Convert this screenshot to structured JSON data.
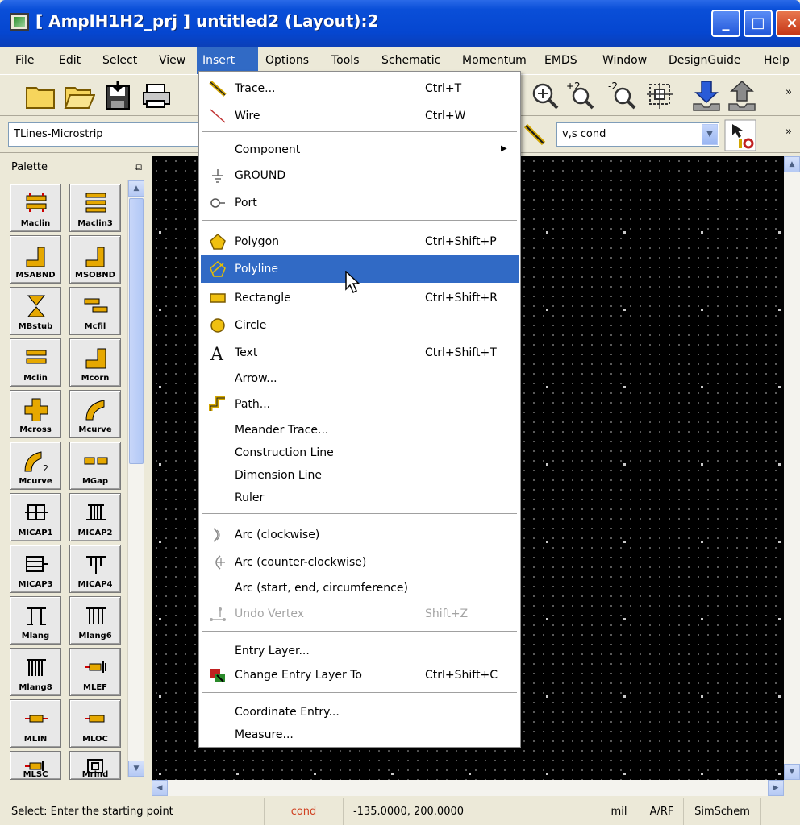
{
  "window": {
    "title": "[ AmplH1H2_prj ] untitled2 (Layout):2",
    "min_label": "_",
    "max_label": "□",
    "close_label": "×"
  },
  "menubar": {
    "items": [
      "File",
      "Edit",
      "Select",
      "View",
      "Insert",
      "Options",
      "Tools",
      "Schematic",
      "Momentum",
      "EMDS",
      "Window",
      "DesignGuide",
      "Help"
    ],
    "active": "Insert"
  },
  "toolbar": {
    "library_value": "TLines-Microstrip",
    "layer_value": "v,s cond",
    "overflow": "»"
  },
  "palette": {
    "header": "Palette",
    "pin_icon": "pin-icon",
    "items": [
      "Maclin",
      "Maclin3",
      "MSABND",
      "MSOBND",
      "MBstub",
      "Mcfil",
      "Mclin",
      "Mcorn",
      "Mcross",
      "Mcurve",
      "Mcurve",
      "MGap",
      "MICAP1",
      "MICAP2",
      "MICAP3",
      "MICAP4",
      "Mlang",
      "Mlang6",
      "Mlang8",
      "MLEF",
      "MLIN",
      "MLOC",
      "MLSC",
      "Mrind"
    ]
  },
  "insert_menu": {
    "groups": [
      [
        {
          "label": "Trace...",
          "shortcut": "Ctrl+T",
          "icon": "trace-icon"
        },
        {
          "label": "Wire",
          "shortcut": "Ctrl+W",
          "icon": "wire-icon"
        }
      ],
      [
        {
          "label": "Component",
          "shortcut": "",
          "icon": "",
          "submenu": true
        },
        {
          "label": "GROUND",
          "shortcut": "",
          "icon": "ground-icon"
        },
        {
          "label": "Port",
          "shortcut": "",
          "icon": "port-icon"
        }
      ],
      [
        {
          "label": "Polygon",
          "shortcut": "Ctrl+Shift+P",
          "icon": "polygon-icon"
        },
        {
          "label": "Polyline",
          "shortcut": "",
          "icon": "polyline-icon",
          "selected": true
        },
        {
          "label": "Rectangle",
          "shortcut": "Ctrl+Shift+R",
          "icon": "rectangle-icon"
        },
        {
          "label": "Circle",
          "shortcut": "",
          "icon": "circle-icon"
        },
        {
          "label": "Text",
          "shortcut": "Ctrl+Shift+T",
          "icon": "text-icon"
        },
        {
          "label": "Arrow...",
          "shortcut": "",
          "icon": ""
        },
        {
          "label": "Path...",
          "shortcut": "",
          "icon": "path-icon"
        },
        {
          "label": "Meander Trace...",
          "shortcut": "",
          "icon": ""
        },
        {
          "label": "Construction Line",
          "shortcut": "",
          "icon": ""
        },
        {
          "label": "Dimension Line",
          "shortcut": "",
          "icon": ""
        },
        {
          "label": "Ruler",
          "shortcut": "",
          "icon": ""
        }
      ],
      [
        {
          "label": "Arc (clockwise)",
          "shortcut": "",
          "icon": "arc-cw-icon"
        },
        {
          "label": "Arc (counter-clockwise)",
          "shortcut": "",
          "icon": "arc-ccw-icon"
        },
        {
          "label": "Arc (start, end, circumference)",
          "shortcut": "",
          "icon": ""
        },
        {
          "label": "Undo Vertex",
          "shortcut": "Shift+Z",
          "icon": "undo-vertex-icon",
          "disabled": true
        }
      ],
      [
        {
          "label": "Entry Layer...",
          "shortcut": "",
          "icon": ""
        },
        {
          "label": "Change Entry Layer To",
          "shortcut": "Ctrl+Shift+C",
          "icon": "change-layer-icon"
        }
      ],
      [
        {
          "label": "Coordinate Entry...",
          "shortcut": "",
          "icon": ""
        },
        {
          "label": "Measure...",
          "shortcut": "",
          "icon": ""
        }
      ]
    ]
  },
  "statusbar": {
    "message": "Select: Enter the starting point",
    "layer": "cond",
    "coords": "-135.0000, 200.0000",
    "units": "mil",
    "mode": "A/RF",
    "view": "SimSchem"
  },
  "colors": {
    "menu_highlight": "#316ac5",
    "title_bar": "#0a4fd8",
    "canvas_bg": "#000000",
    "status_layer": "#d04020"
  }
}
